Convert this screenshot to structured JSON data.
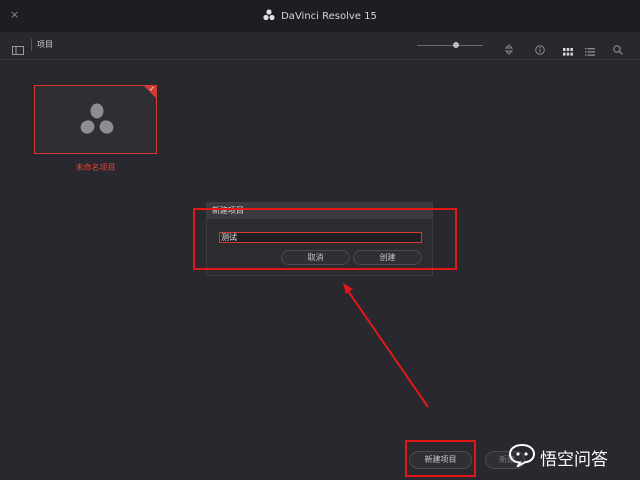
{
  "window": {
    "close_glyph": "×",
    "title": "DaVinci Resolve 15"
  },
  "toolbar": {
    "breadcrumb": "项目",
    "icons": [
      "sidebar-toggle-icon",
      "zoom-slider",
      "sort-icon",
      "info-icon",
      "grid-view-icon",
      "list-view-icon",
      "search-icon"
    ]
  },
  "projects": [
    {
      "label": "未命名项目",
      "selected": true
    }
  ],
  "dialog": {
    "title": "新建项目",
    "input_value": "测试",
    "cancel_label": "取消",
    "create_label": "创建"
  },
  "footer": {
    "new_project_label": "新建项目",
    "second_button_label": "新建"
  },
  "watermark": {
    "text": "悟空问答"
  },
  "colors": {
    "accent": "#d23b34",
    "highlight": "#e21818",
    "background": "#28282e"
  }
}
